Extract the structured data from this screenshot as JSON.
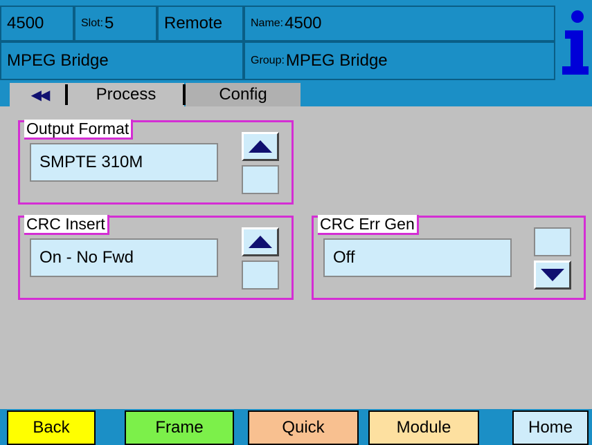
{
  "header": {
    "device": "4500",
    "slot_label": "Slot:",
    "slot_value": "5",
    "mode": "Remote",
    "name_label": "Name:",
    "name_value": "4500",
    "module": "MPEG Bridge",
    "group_label": "Group:",
    "group_value": "MPEG Bridge",
    "info_icon": "info-icon"
  },
  "tabs": {
    "back_glyph": "◀◀",
    "process": "Process",
    "config": "Config"
  },
  "panels": {
    "output_format": {
      "title": "Output Format",
      "value": "SMPTE 310M",
      "up_icon": "triangle-up-icon"
    },
    "crc_insert": {
      "title": "CRC Insert",
      "value": "On - No Fwd",
      "up_icon": "triangle-up-icon"
    },
    "crc_err_gen": {
      "title": "CRC Err Gen",
      "value": "Off",
      "down_icon": "triangle-down-icon"
    }
  },
  "footer": {
    "back": "Back",
    "frame": "Frame",
    "quick": "Quick",
    "module": "Module",
    "home": "Home"
  },
  "colors": {
    "header_bg": "#1b8fc6",
    "body_bg": "#c0c0c0",
    "panel_border": "#d42ed4",
    "field_bg": "#cfecfa",
    "back_btn": "#ffff00",
    "frame_btn": "#7cf04a",
    "quick_btn": "#f8c090",
    "module_btn": "#fde0a0",
    "home_btn": "#cfecfa",
    "arrow": "#101070"
  }
}
